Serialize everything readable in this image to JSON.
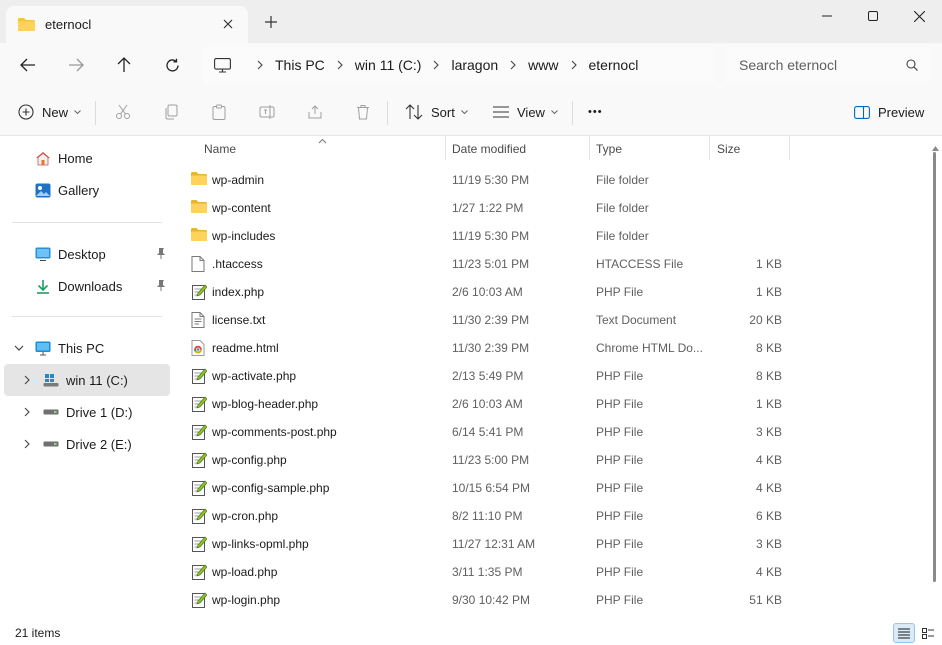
{
  "window": {
    "tab_title": "eternocl"
  },
  "address": {
    "crumbs": [
      "This PC",
      "win 11 (C:)",
      "laragon",
      "www",
      "eternocl"
    ]
  },
  "search": {
    "placeholder": "Search eternocl"
  },
  "toolbar": {
    "new_label": "New",
    "sort_label": "Sort",
    "view_label": "View",
    "more_label": "•••",
    "preview_label": "Preview"
  },
  "sidebar": {
    "quick": [
      {
        "label": "Home",
        "icon": "home-icon"
      },
      {
        "label": "Gallery",
        "icon": "gallery-icon"
      }
    ],
    "pinned": [
      {
        "label": "Desktop",
        "icon": "desktop-icon"
      },
      {
        "label": "Downloads",
        "icon": "downloads-icon"
      }
    ],
    "this_pc": {
      "label": "This PC",
      "icon": "this-pc-icon"
    },
    "drives": [
      {
        "label": "win 11 (C:)",
        "icon": "windows-drive-icon",
        "selected": true
      },
      {
        "label": "Drive 1 (D:)",
        "icon": "drive-icon",
        "selected": false
      },
      {
        "label": "Drive 2 (E:)",
        "icon": "drive-icon",
        "selected": false
      }
    ]
  },
  "columns": {
    "name": "Name",
    "date": "Date modified",
    "type": "Type",
    "size": "Size"
  },
  "files": [
    {
      "name": "wp-admin",
      "date": "11/19 5:30 PM",
      "type": "File folder",
      "size": "",
      "icon": "folder-icon"
    },
    {
      "name": "wp-content",
      "date": "1/27 1:22 PM",
      "type": "File folder",
      "size": "",
      "icon": "folder-icon"
    },
    {
      "name": "wp-includes",
      "date": "11/19 5:30 PM",
      "type": "File folder",
      "size": "",
      "icon": "folder-icon"
    },
    {
      "name": ".htaccess",
      "date": "11/23 5:01 PM",
      "type": "HTACCESS File",
      "size": "1 KB",
      "icon": "file-icon"
    },
    {
      "name": "index.php",
      "date": "2/6 10:03 AM",
      "type": "PHP File",
      "size": "1 KB",
      "icon": "php-file-icon"
    },
    {
      "name": "license.txt",
      "date": "11/30 2:39 PM",
      "type": "Text Document",
      "size": "20 KB",
      "icon": "text-file-icon"
    },
    {
      "name": "readme.html",
      "date": "11/30 2:39 PM",
      "type": "Chrome HTML Do...",
      "size": "8 KB",
      "icon": "chrome-html-icon"
    },
    {
      "name": "wp-activate.php",
      "date": "2/13 5:49 PM",
      "type": "PHP File",
      "size": "8 KB",
      "icon": "php-file-icon"
    },
    {
      "name": "wp-blog-header.php",
      "date": "2/6 10:03 AM",
      "type": "PHP File",
      "size": "1 KB",
      "icon": "php-file-icon"
    },
    {
      "name": "wp-comments-post.php",
      "date": "6/14 5:41 PM",
      "type": "PHP File",
      "size": "3 KB",
      "icon": "php-file-icon"
    },
    {
      "name": "wp-config.php",
      "date": "11/23 5:00 PM",
      "type": "PHP File",
      "size": "4 KB",
      "icon": "php-file-icon"
    },
    {
      "name": "wp-config-sample.php",
      "date": "10/15 6:54 PM",
      "type": "PHP File",
      "size": "4 KB",
      "icon": "php-file-icon"
    },
    {
      "name": "wp-cron.php",
      "date": "8/2 11:10 PM",
      "type": "PHP File",
      "size": "6 KB",
      "icon": "php-file-icon"
    },
    {
      "name": "wp-links-opml.php",
      "date": "11/27 12:31 AM",
      "type": "PHP File",
      "size": "3 KB",
      "icon": "php-file-icon"
    },
    {
      "name": "wp-load.php",
      "date": "3/11 1:35 PM",
      "type": "PHP File",
      "size": "4 KB",
      "icon": "php-file-icon"
    },
    {
      "name": "wp-login.php",
      "date": "9/30 10:42 PM",
      "type": "PHP File",
      "size": "51 KB",
      "icon": "php-file-icon"
    }
  ],
  "status": {
    "item_count": "21 items"
  },
  "colors": {
    "folder": "#f5c443",
    "accent": "#0067c0",
    "selected_bg": "#e5e5e5"
  }
}
